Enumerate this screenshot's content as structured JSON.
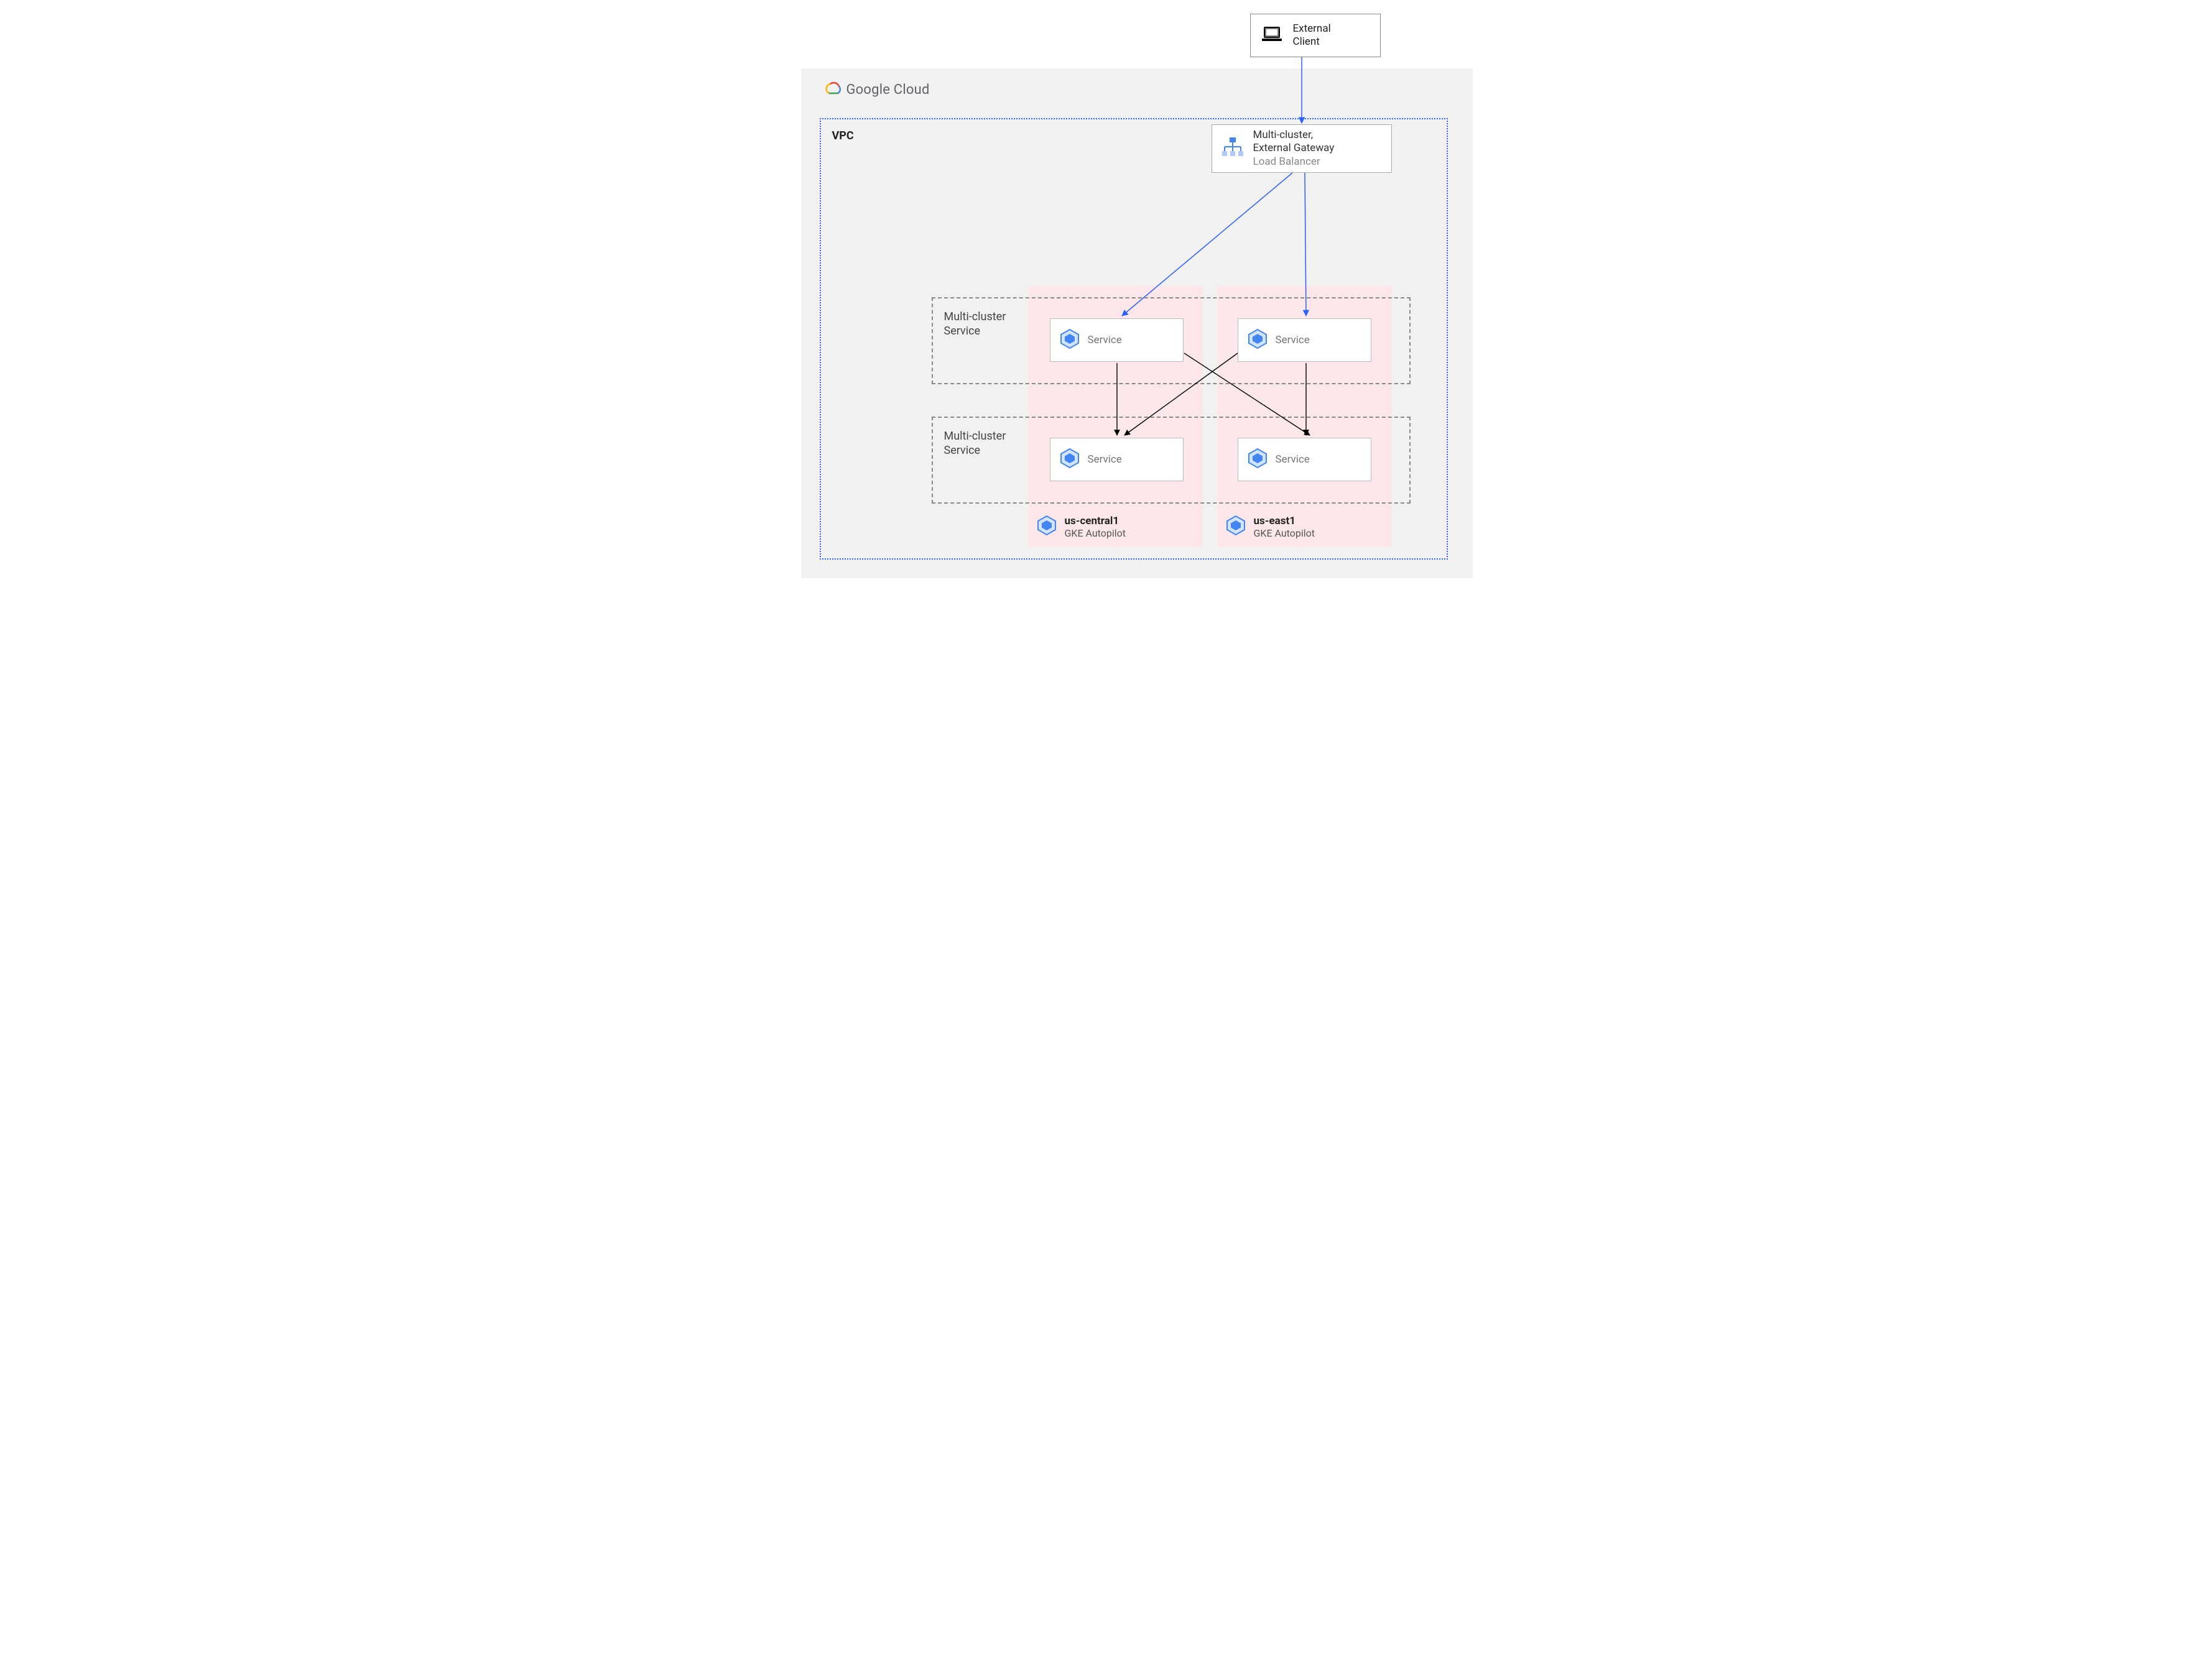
{
  "externalClient": {
    "line1": "External",
    "line2": "Client"
  },
  "vpcLabel": "VPC",
  "googleCloud": "Google Cloud",
  "gateway": {
    "line1": "Multi-cluster,",
    "line2": "External Gateway",
    "sub": "Load Balancer"
  },
  "mcs": {
    "label_line1": "Multi-cluster",
    "label_line2": "Service"
  },
  "service": {
    "label": "Service"
  },
  "regions": {
    "a": {
      "name": "us-central1",
      "sub": "GKE Autopilot"
    },
    "b": {
      "name": "us-east1",
      "sub": "GKE Autopilot"
    }
  }
}
